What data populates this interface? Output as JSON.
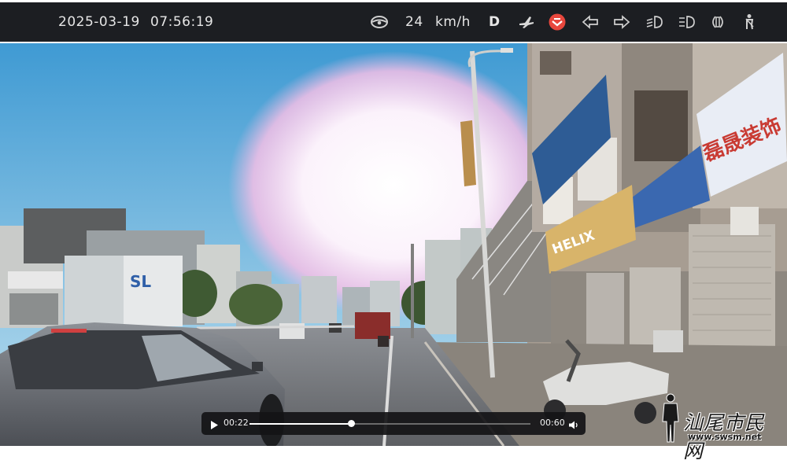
{
  "status_bar": {
    "date": "2025-03-19",
    "time": "07:56:19",
    "speed_value": "24",
    "speed_unit": "km/h",
    "gear": "D",
    "icons": [
      "steering-wheel-icon",
      "airplane-icon",
      "speed-camera-warning-icon",
      "left-turn-signal-icon",
      "right-turn-signal-icon",
      "low-beam-icon",
      "high-beam-icon",
      "parking-light-icon",
      "seatbelt-icon"
    ],
    "warning_color": "#e8473d"
  },
  "player": {
    "current_time": "00:22",
    "duration": "00:60",
    "progress": 0.36
  },
  "scene_signs": {
    "truck_logo": "SL",
    "shop_red_sign": "HELIX",
    "building_blue_sign": "磊晟装饰"
  },
  "watermark": {
    "text": "汕尾市民网",
    "url": "www.swsm.net"
  }
}
